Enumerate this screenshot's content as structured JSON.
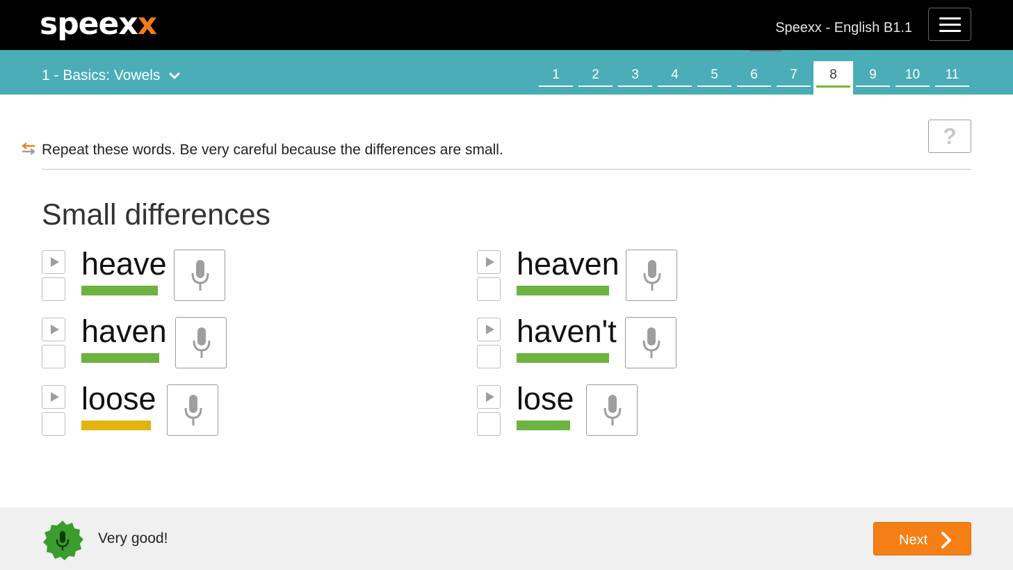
{
  "header": {
    "logo_text": "speex",
    "logo_accent": "x",
    "course_title": "Speexx - English B1.1",
    "menu_icon": "hamburger-icon"
  },
  "lessonbar": {
    "lesson_title": "1 - Basics: Vowels",
    "steps": [
      "1",
      "2",
      "3",
      "4",
      "5",
      "6",
      "7",
      "8",
      "9",
      "10",
      "11"
    ],
    "active_step": "8"
  },
  "instruction": {
    "text": "Repeat these words. Be very careful because the differences are small.",
    "help_label": "?"
  },
  "section_title": "Small differences",
  "words": [
    {
      "word": "heave",
      "score": "good"
    },
    {
      "word": "heaven",
      "score": "good"
    },
    {
      "word": "haven",
      "score": "good"
    },
    {
      "word": "haven't",
      "score": "good"
    },
    {
      "word": "loose",
      "score": "medium"
    },
    {
      "word": "lose",
      "score": "good"
    }
  ],
  "footer": {
    "feedback": "Very good!",
    "next_label": "Next"
  },
  "colors": {
    "brand_orange": "#f07d1a",
    "teal": "#4aadb7",
    "score_good": "#6db33f",
    "score_medium": "#e2b40d",
    "next_button": "#f57f14",
    "badge_green": "#3a9d2e"
  }
}
